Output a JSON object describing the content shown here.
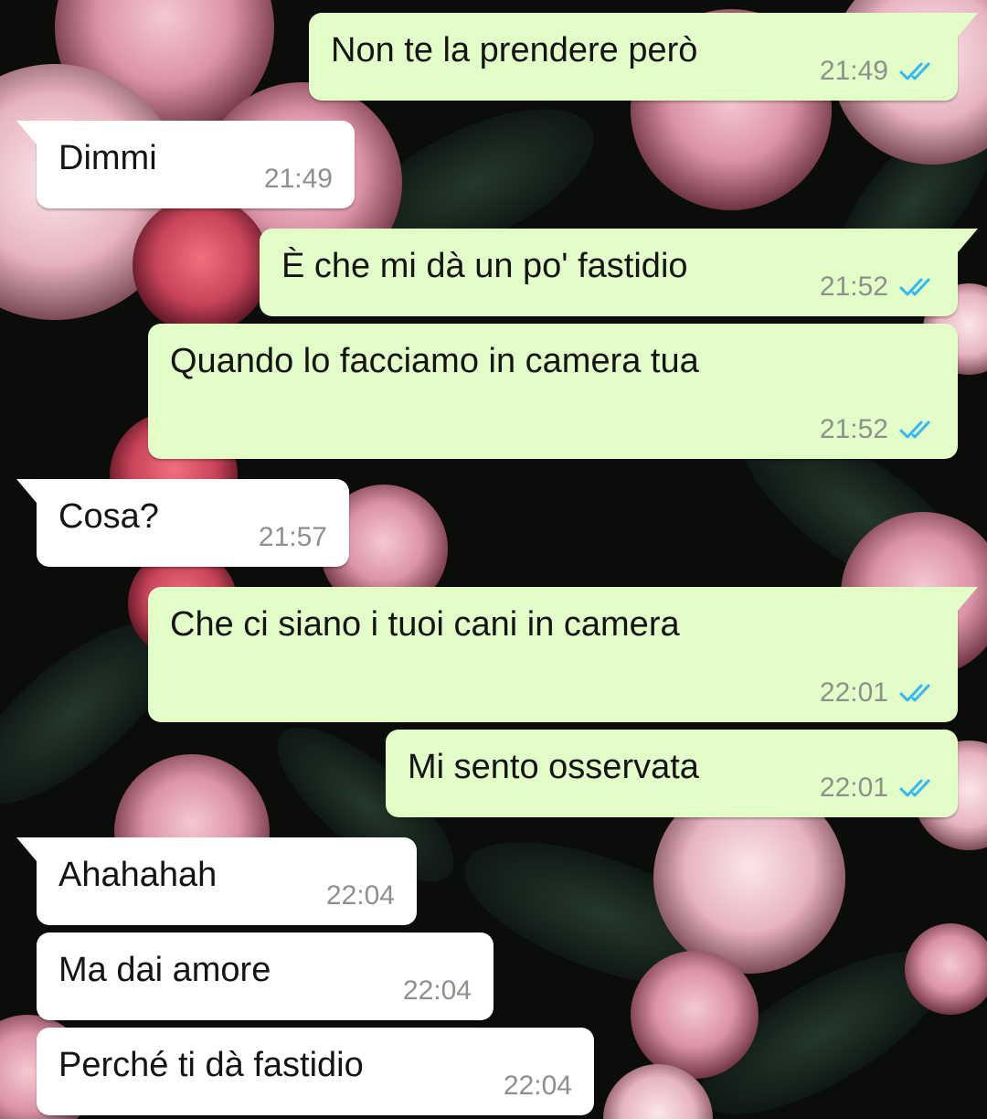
{
  "theme": {
    "outgoing_bubble": "#e2fdc7",
    "incoming_bubble": "#ffffff",
    "read_tick": "#34b7f1",
    "timestamp": "#8d918c",
    "wallpaper": "dark floral pink roses"
  },
  "messages": [
    {
      "direction": "out",
      "text": "Non te la prendere però",
      "time": "21:49",
      "status": "read",
      "status_icon": "double-check-icon"
    },
    {
      "direction": "in",
      "text": "Dimmi",
      "time": "21:49"
    },
    {
      "direction": "out",
      "text": "È che mi dà un po' fastidio",
      "time": "21:52",
      "status": "read",
      "status_icon": "double-check-icon"
    },
    {
      "direction": "out",
      "text": "Quando lo facciamo in camera tua",
      "time": "21:52",
      "status": "read",
      "status_icon": "double-check-icon"
    },
    {
      "direction": "in",
      "text": "Cosa?",
      "time": "21:57"
    },
    {
      "direction": "out",
      "text": "Che ci siano i tuoi cani in camera",
      "time": "22:01",
      "status": "read",
      "status_icon": "double-check-icon"
    },
    {
      "direction": "out",
      "text": "Mi sento osservata",
      "time": "22:01",
      "status": "read",
      "status_icon": "double-check-icon"
    },
    {
      "direction": "in",
      "text": "Ahahahah",
      "time": "22:04"
    },
    {
      "direction": "in",
      "text": "Ma dai amore",
      "time": "22:04"
    },
    {
      "direction": "in",
      "text": "Perché ti dà fastidio",
      "time": "22:04"
    }
  ]
}
